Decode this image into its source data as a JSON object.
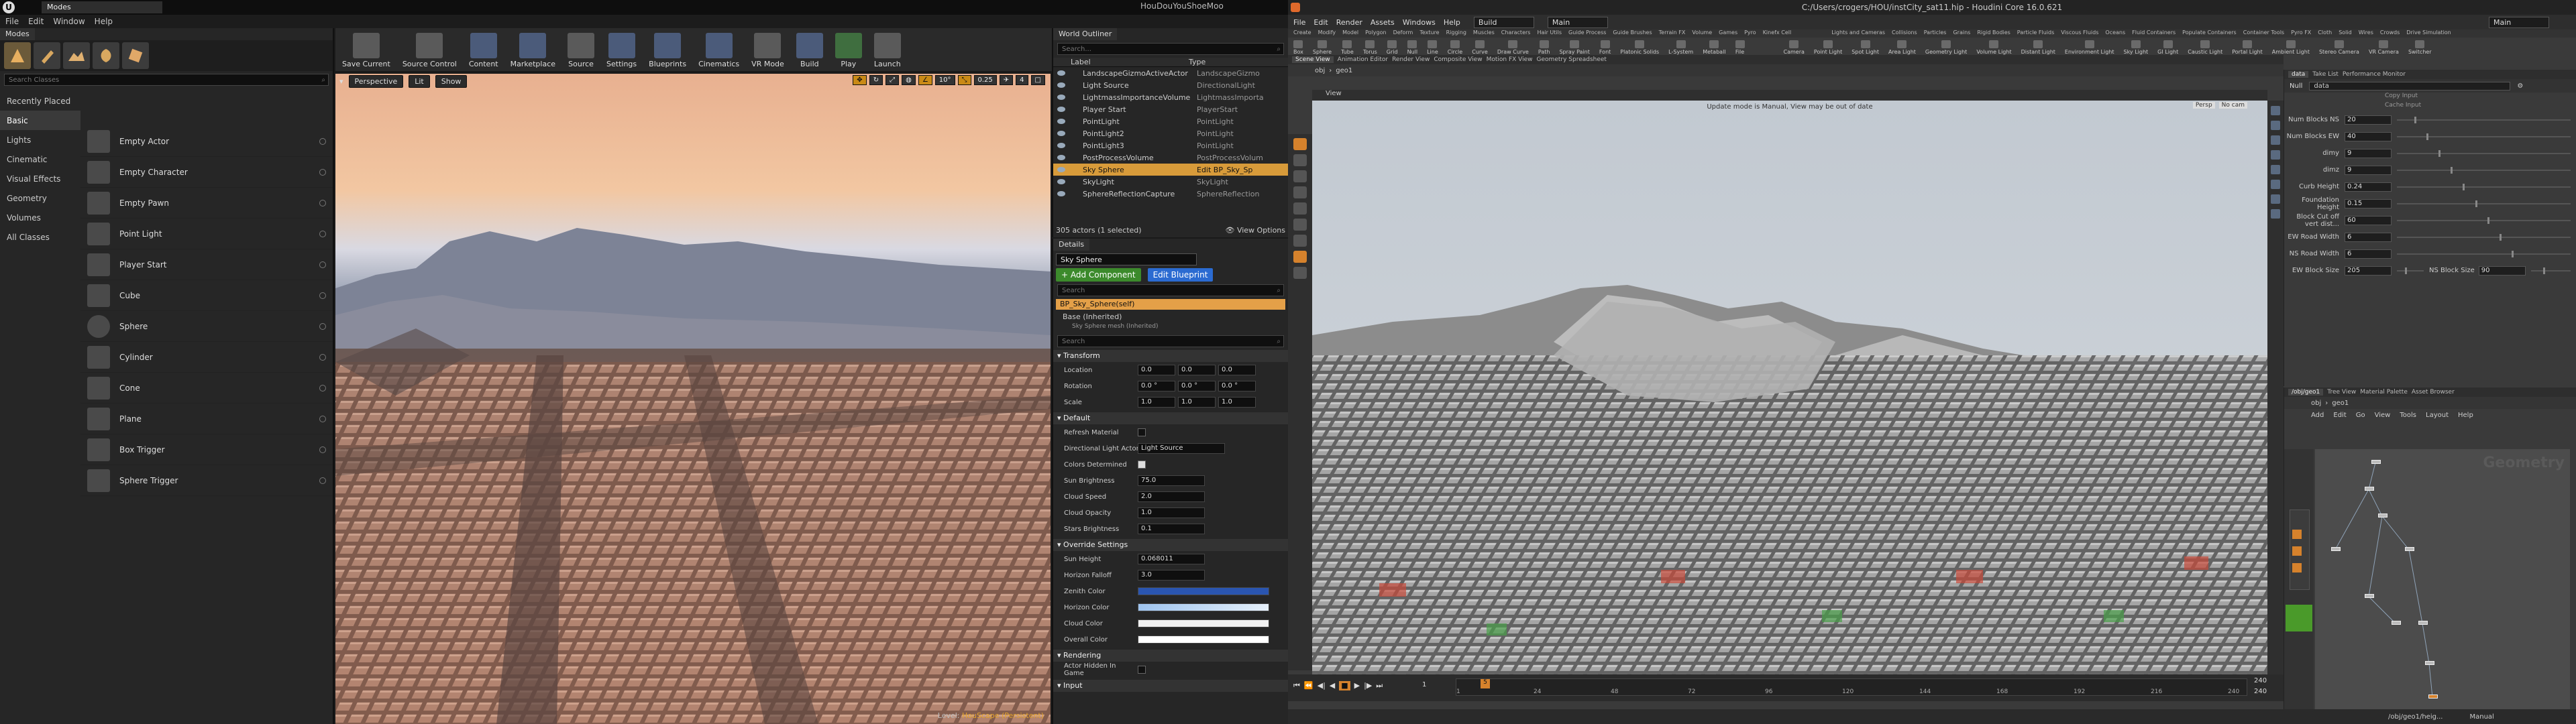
{
  "ue": {
    "tab_title": "Modes",
    "project_title": "HouDouYouShoeMoo",
    "menu": [
      "File",
      "Edit",
      "Window",
      "Help"
    ],
    "modes_tab": "Modes",
    "search_placeholder": "Search Classes",
    "categories": [
      "Recently Placed",
      "Basic",
      "Lights",
      "Cinematic",
      "Visual Effects",
      "Geometry",
      "Volumes",
      "All Classes"
    ],
    "place_items": [
      "Empty Actor",
      "Empty Character",
      "Empty Pawn",
      "Point Light",
      "Player Start",
      "Cube",
      "Sphere",
      "Cylinder",
      "Cone",
      "Plane",
      "Box Trigger",
      "Sphere Trigger"
    ],
    "toolbar": [
      "Save Current",
      "Source Control",
      "Content",
      "Marketplace",
      "Source",
      "Settings",
      "Blueprints",
      "Cinematics",
      "VR Mode",
      "Build",
      "Play",
      "Launch"
    ],
    "viewport": {
      "mode": "Perspective",
      "lit": "Lit",
      "show": "Show",
      "chip_angle": "10°",
      "chip_scale": "0.25",
      "chip_speed": "4",
      "level_label": "Level:",
      "level_name": "HouScape (Persistent)"
    },
    "outliner": {
      "tab": "World Outliner",
      "search_placeholder": "Search...",
      "col_label": "Label",
      "col_type": "Type",
      "rows": [
        {
          "label": "LandscapeGizmoActiveActor",
          "type": "LandscapeGizmo"
        },
        {
          "label": "Light Source",
          "type": "DirectionalLight"
        },
        {
          "label": "LightmassImportanceVolume",
          "type": "LightmassImporta"
        },
        {
          "label": "Player Start",
          "type": "PlayerStart"
        },
        {
          "label": "PointLight",
          "type": "PointLight"
        },
        {
          "label": "PointLight2",
          "type": "PointLight"
        },
        {
          "label": "PointLight3",
          "type": "PointLight"
        },
        {
          "label": "PostProcessVolume",
          "type": "PostProcessVolum"
        },
        {
          "label": "Sky Sphere",
          "type": "Edit BP_Sky_Sp"
        },
        {
          "label": "SkyLight",
          "type": "SkyLight"
        },
        {
          "label": "SphereReflectionCapture",
          "type": "SphereReflection"
        }
      ],
      "selected_index": 8,
      "count": "305 actors (1 selected)",
      "view_options": "View Options"
    },
    "details": {
      "tab": "Details",
      "name": "Sky Sphere",
      "add_component": "+ Add Component",
      "edit_blueprint": "Edit Blueprint",
      "component": "BP_Sky_Sphere(self)",
      "base": "Base (Inherited)",
      "base_sub": "Sky Sphere mesh (Inherited)",
      "search_placeholder": "Search",
      "transform": "Transform",
      "location_label": "Location",
      "location": [
        "0.0",
        "0.0",
        "0.0"
      ],
      "rotation_label": "Rotation",
      "rotation": [
        "0.0 °",
        "0.0 °",
        "0.0 °"
      ],
      "scale_label": "Scale",
      "scale": [
        "1.0",
        "1.0",
        "1.0"
      ],
      "default": "Default",
      "refresh_material": "Refresh Material",
      "dir_light_actor": "Directional Light Actor",
      "dir_light_value": "Light Source",
      "colors_determined": "Colors Determined",
      "sun_brightness_label": "Sun Brightness",
      "sun_brightness": "75.0",
      "cloud_speed_label": "Cloud Speed",
      "cloud_speed": "2.0",
      "cloud_opacity_label": "Cloud Opacity",
      "cloud_opacity": "1.0",
      "stars_brightness_label": "Stars Brightness",
      "stars_brightness": "0.1",
      "override": "Override Settings",
      "sun_height_label": "Sun Height",
      "sun_height": "0.068011",
      "horizon_falloff_label": "Horizon Falloff",
      "horizon_falloff": "3.0",
      "zenith_color": "Zenith Color",
      "horizon_color": "Horizon Color",
      "cloud_color": "Cloud Color",
      "overall_color": "Overall Color",
      "rendering": "Rendering",
      "actor_hidden": "Actor Hidden In Game",
      "input": "Input"
    }
  },
  "hou": {
    "title": "C:/Users/crogers/HOU/instCity_sat11.hip - Houdini Core 16.0.621",
    "menu": [
      "File",
      "Edit",
      "Render",
      "Assets",
      "Windows",
      "Help"
    ],
    "desktop": "Build",
    "context": "Main",
    "right_dd": "Main",
    "shelf_tabs": [
      "Create",
      "Modify",
      "Model",
      "Polygon",
      "Deform",
      "Texture",
      "Rigging",
      "Muscles",
      "Characters",
      "Hair Utils",
      "Guide Process",
      "Guide Brushes",
      "Terrain FX",
      "Volume",
      "Games",
      "Pyro",
      "Kinefx Cell"
    ],
    "shelf_tools": [
      "Box",
      "Sphere",
      "Tube",
      "Torus",
      "Grid",
      "Null",
      "Line",
      "Circle",
      "Curve",
      "Draw Curve",
      "Path",
      "Spray Paint",
      "Font",
      "Platonic Solids",
      "L-System",
      "Metaball",
      "File"
    ],
    "lights_tabs": [
      "Lights and Cameras",
      "Collisions",
      "Particles",
      "Grains",
      "Rigid Bodies",
      "Particle Fluids",
      "Viscous Fluids",
      "Oceans",
      "Fluid Containers",
      "Populate Containers",
      "Container Tools",
      "Pyro FX",
      "Cloth",
      "Solid",
      "Wires",
      "Crowds",
      "Drive Simulation"
    ],
    "lights_tools": [
      "Camera",
      "Point Light",
      "Spot Light",
      "Area Light",
      "Geometry Light",
      "Volume Light",
      "Distant Light",
      "Environment Light",
      "Sky Light",
      "GI Light",
      "Caustic Light",
      "Portal Light",
      "Ambient Light",
      "Stereo Camera",
      "VR Camera",
      "Switcher"
    ],
    "vp_tabs": [
      "Scene View",
      "Animation Editor",
      "Render View",
      "Composite View",
      "Motion FX View",
      "Geometry Spreadsheet"
    ],
    "path_obj": "obj",
    "path_geo": "geo1",
    "view_label": "View",
    "vp_message": "Update mode is Manual, View may be out of date",
    "persp": "Persp",
    "nocam": "No cam",
    "params_tabs": [
      "data",
      "Take List",
      "Performance Monitor"
    ],
    "param_node_type": "Null",
    "param_node": "data",
    "copy_input": "Copy Input",
    "cache_input": "Cache Input",
    "params": [
      {
        "label": "Num Blocks NS",
        "value": "20"
      },
      {
        "label": "Num Blocks EW",
        "value": "40"
      },
      {
        "label": "dimy",
        "value": "9"
      },
      {
        "label": "dimz",
        "value": "9"
      },
      {
        "label": "Curb Height",
        "value": "0.24"
      },
      {
        "label": "Foundation Height",
        "value": "0.15"
      },
      {
        "label": "Block Cut off vert dist...",
        "value": "60"
      },
      {
        "label": "EW Road Width",
        "value": "6"
      },
      {
        "label": "NS Road Width",
        "value": "6"
      }
    ],
    "ew_block_label": "EW Block Size",
    "ew_block": "205",
    "ns_block_label": "NS Block Size",
    "ns_block": "90",
    "net_tabs": [
      "/obj/geo1",
      "Tree View",
      "Material Palette",
      "Asset Browser"
    ],
    "net_menu": [
      "Add",
      "Edit",
      "Go",
      "View",
      "Tools",
      "Layout",
      "Help"
    ],
    "net_watermark": "Geometry",
    "frame_start": "1",
    "frame_current": "5",
    "frame_end": "240",
    "frame_end2": "240",
    "ticks": [
      "1",
      "24",
      "48",
      "72",
      "96",
      "120",
      "144",
      "168",
      "192",
      "216",
      "240"
    ],
    "status_path": "/obj/geo1/heig...",
    "auto_update": "Manual"
  }
}
